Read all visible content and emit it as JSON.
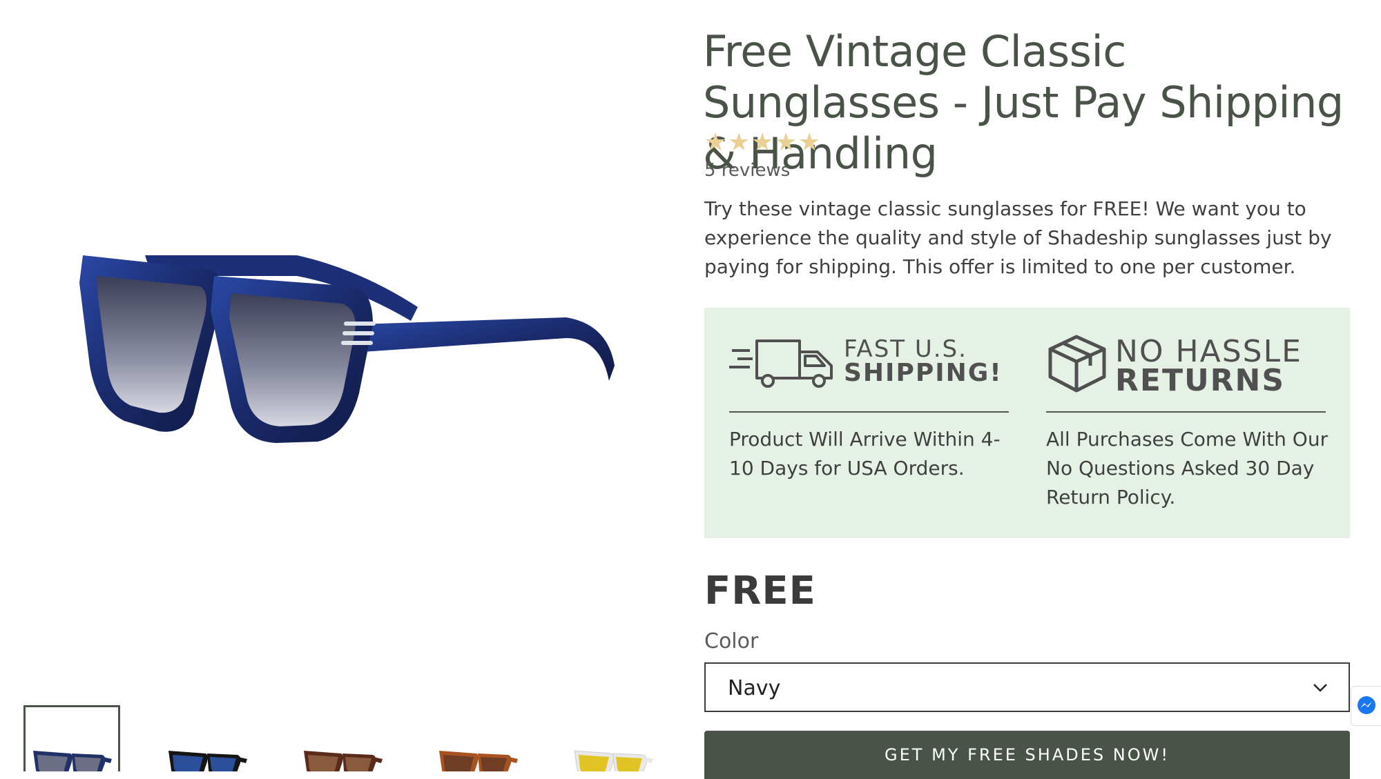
{
  "gallery": {
    "main_image_alt": "Navy vintage classic sunglasses",
    "thumbnails": [
      {
        "name": "navy",
        "frame": "#1f3168",
        "lens": "#6c6f86",
        "selected": true
      },
      {
        "name": "black-blue",
        "frame": "#151515",
        "lens": "#2c4f9c",
        "selected": false
      },
      {
        "name": "brown",
        "frame": "#5a2b1a",
        "lens": "#8a5a3e",
        "selected": false
      },
      {
        "name": "tortoise",
        "frame": "#a8531f",
        "lens": "#6e3d24",
        "selected": false
      },
      {
        "name": "white-yellow",
        "frame": "#e8e8e8",
        "lens": "#e2c324",
        "selected": false
      }
    ]
  },
  "product": {
    "title": "Free Vintage Classic Sunglasses - Just Pay Shipping & Handling",
    "rating": 5,
    "reviews_label": "5 reviews",
    "description": "Try these vintage classic sunglasses for FREE! We want you to experience the quality and style of Shadeship sunglasses just by paying for shipping. This offer is limited to one per customer.",
    "price": "FREE",
    "color_label": "Color",
    "selected_color": "Navy",
    "cta_label": "GET MY FREE SHADES NOW!"
  },
  "benefits": [
    {
      "icon": "truck-icon",
      "badge_line1": "FAST U.S.",
      "badge_line2": "SHIPPING!",
      "text": "Product Will Arrive Within 4-10 Days for USA Orders."
    },
    {
      "icon": "box-icon",
      "badge_line1": "NO HASSLE",
      "badge_line2": "RETURNS",
      "text": "All Purchases Come With Our No Questions Asked 30 Day Return Policy."
    }
  ],
  "colors": {
    "brand_green": "#4a5347",
    "benefit_bg": "#e6f1e6",
    "star": "#ead095"
  },
  "widgets": {
    "messenger_icon": "messenger-icon"
  }
}
